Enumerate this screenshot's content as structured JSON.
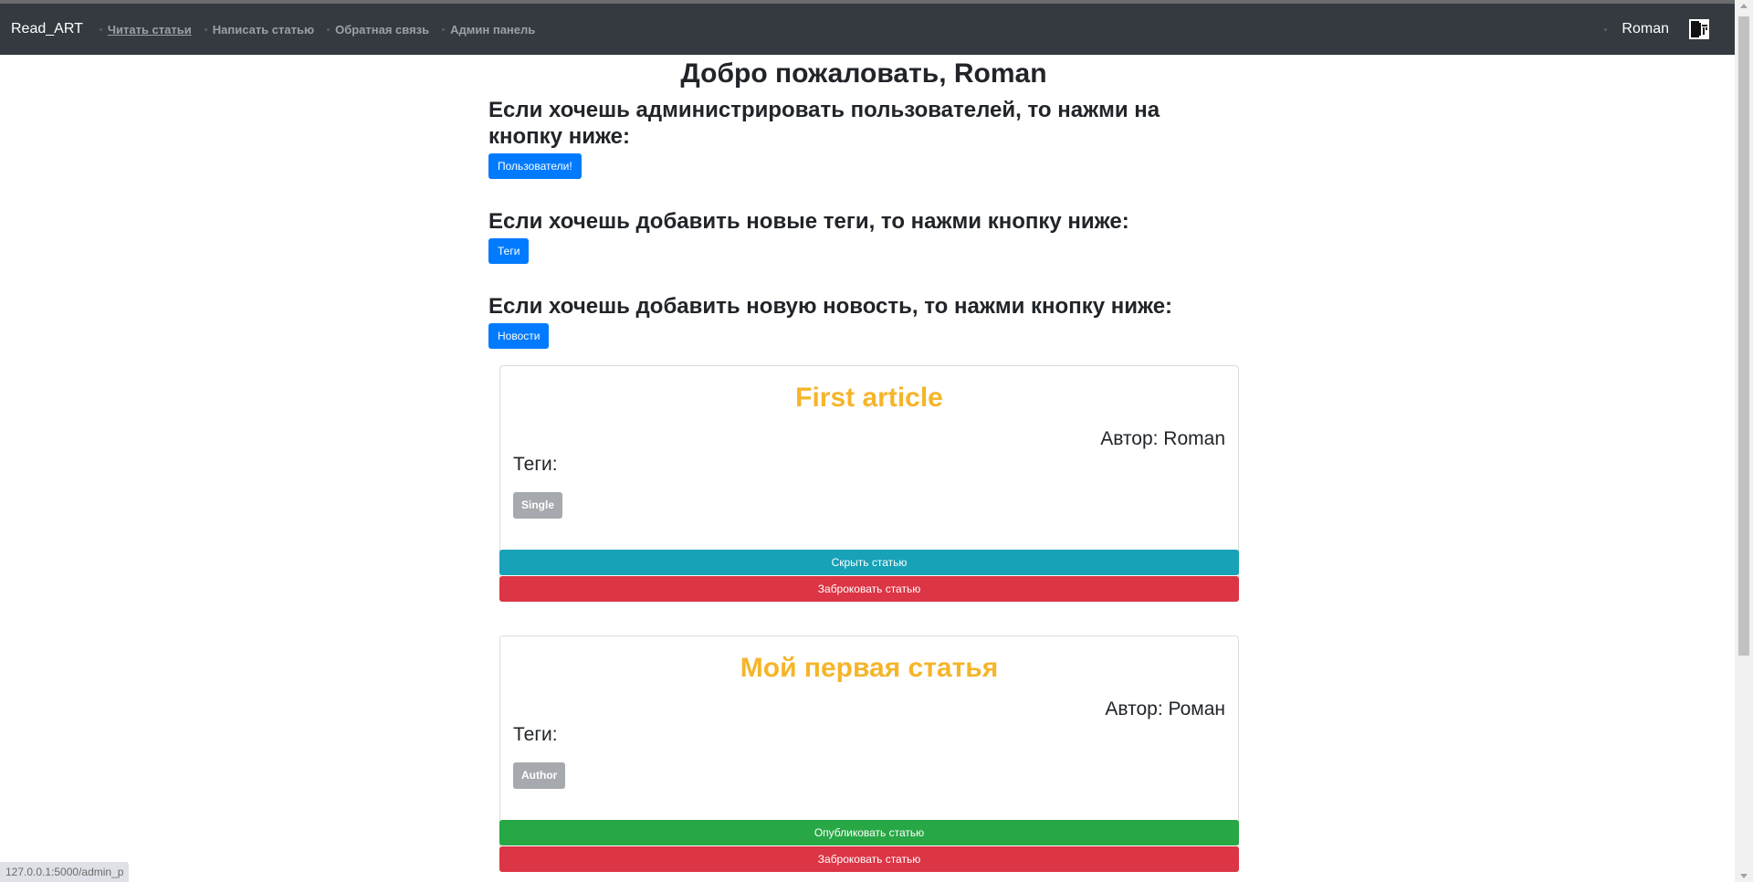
{
  "navbar": {
    "brand": "Read_ART",
    "links": [
      "Читать статьи",
      "Написать статью",
      "Обратная связь",
      "Админ панель"
    ],
    "user_name": "Roman"
  },
  "main": {
    "welcome": "Добро пожаловать, Roman",
    "sections": [
      {
        "text": "Если хочешь администрировать пользователей, то нажми на кнопку ниже:",
        "button": "Пользователи!"
      },
      {
        "text": "Если хочешь добавить новые теги, то нажми кнопку ниже:",
        "button": "Теги"
      },
      {
        "text": "Если хочешь добавить новую новость, то нажми кнопку ниже:",
        "button": "Новости"
      }
    ]
  },
  "articles": [
    {
      "title": "First article",
      "author": "Автор: Roman",
      "tags_label": "Теги:",
      "tag": "Single",
      "action_button": "Скрыть статью",
      "reject_button": "Заброковать статью"
    },
    {
      "title": "Мой первая статья",
      "author": "Автор: Роман",
      "tags_label": "Теги:",
      "tag": "Author",
      "action_button": "Опубликовать статью",
      "reject_button": "Заброковать статью"
    }
  ],
  "status_bar": {
    "url": "127.0.0.1:5000/admin_p"
  },
  "colors": {
    "navbar": "#343a40",
    "primary": "#007bff",
    "info": "#17a2b8",
    "success": "#28a745",
    "danger": "#dc3545",
    "title_accent": "#f5b52a",
    "badge": "#a6a9ad"
  }
}
